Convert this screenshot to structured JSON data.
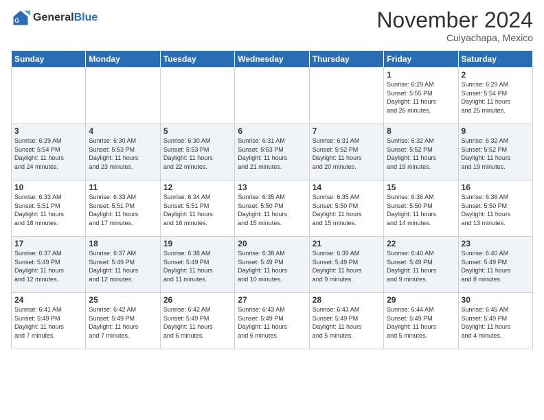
{
  "header": {
    "logo_general": "General",
    "logo_blue": "Blue",
    "month_title": "November 2024",
    "location": "Cuiyachapa, Mexico"
  },
  "weekdays": [
    "Sunday",
    "Monday",
    "Tuesday",
    "Wednesday",
    "Thursday",
    "Friday",
    "Saturday"
  ],
  "weeks": [
    [
      {
        "day": "",
        "info": ""
      },
      {
        "day": "",
        "info": ""
      },
      {
        "day": "",
        "info": ""
      },
      {
        "day": "",
        "info": ""
      },
      {
        "day": "",
        "info": ""
      },
      {
        "day": "1",
        "info": "Sunrise: 6:29 AM\nSunset: 5:55 PM\nDaylight: 11 hours\nand 26 minutes."
      },
      {
        "day": "2",
        "info": "Sunrise: 6:29 AM\nSunset: 5:54 PM\nDaylight: 11 hours\nand 25 minutes."
      }
    ],
    [
      {
        "day": "3",
        "info": "Sunrise: 6:29 AM\nSunset: 5:54 PM\nDaylight: 11 hours\nand 24 minutes."
      },
      {
        "day": "4",
        "info": "Sunrise: 6:30 AM\nSunset: 5:53 PM\nDaylight: 11 hours\nand 23 minutes."
      },
      {
        "day": "5",
        "info": "Sunrise: 6:30 AM\nSunset: 5:53 PM\nDaylight: 11 hours\nand 22 minutes."
      },
      {
        "day": "6",
        "info": "Sunrise: 6:31 AM\nSunset: 5:53 PM\nDaylight: 11 hours\nand 21 minutes."
      },
      {
        "day": "7",
        "info": "Sunrise: 6:31 AM\nSunset: 5:52 PM\nDaylight: 11 hours\nand 20 minutes."
      },
      {
        "day": "8",
        "info": "Sunrise: 6:32 AM\nSunset: 5:52 PM\nDaylight: 11 hours\nand 19 minutes."
      },
      {
        "day": "9",
        "info": "Sunrise: 6:32 AM\nSunset: 5:52 PM\nDaylight: 11 hours\nand 19 minutes."
      }
    ],
    [
      {
        "day": "10",
        "info": "Sunrise: 6:33 AM\nSunset: 5:51 PM\nDaylight: 11 hours\nand 18 minutes."
      },
      {
        "day": "11",
        "info": "Sunrise: 6:33 AM\nSunset: 5:51 PM\nDaylight: 11 hours\nand 17 minutes."
      },
      {
        "day": "12",
        "info": "Sunrise: 6:34 AM\nSunset: 5:51 PM\nDaylight: 11 hours\nand 16 minutes."
      },
      {
        "day": "13",
        "info": "Sunrise: 6:35 AM\nSunset: 5:50 PM\nDaylight: 11 hours\nand 15 minutes."
      },
      {
        "day": "14",
        "info": "Sunrise: 6:35 AM\nSunset: 5:50 PM\nDaylight: 11 hours\nand 15 minutes."
      },
      {
        "day": "15",
        "info": "Sunrise: 6:36 AM\nSunset: 5:50 PM\nDaylight: 11 hours\nand 14 minutes."
      },
      {
        "day": "16",
        "info": "Sunrise: 6:36 AM\nSunset: 5:50 PM\nDaylight: 11 hours\nand 13 minutes."
      }
    ],
    [
      {
        "day": "17",
        "info": "Sunrise: 6:37 AM\nSunset: 5:49 PM\nDaylight: 11 hours\nand 12 minutes."
      },
      {
        "day": "18",
        "info": "Sunrise: 6:37 AM\nSunset: 5:49 PM\nDaylight: 11 hours\nand 12 minutes."
      },
      {
        "day": "19",
        "info": "Sunrise: 6:38 AM\nSunset: 5:49 PM\nDaylight: 11 hours\nand 11 minutes."
      },
      {
        "day": "20",
        "info": "Sunrise: 6:38 AM\nSunset: 5:49 PM\nDaylight: 11 hours\nand 10 minutes."
      },
      {
        "day": "21",
        "info": "Sunrise: 6:39 AM\nSunset: 5:49 PM\nDaylight: 11 hours\nand 9 minutes."
      },
      {
        "day": "22",
        "info": "Sunrise: 6:40 AM\nSunset: 5:49 PM\nDaylight: 11 hours\nand 9 minutes."
      },
      {
        "day": "23",
        "info": "Sunrise: 6:40 AM\nSunset: 5:49 PM\nDaylight: 11 hours\nand 8 minutes."
      }
    ],
    [
      {
        "day": "24",
        "info": "Sunrise: 6:41 AM\nSunset: 5:49 PM\nDaylight: 11 hours\nand 7 minutes."
      },
      {
        "day": "25",
        "info": "Sunrise: 6:42 AM\nSunset: 5:49 PM\nDaylight: 11 hours\nand 7 minutes."
      },
      {
        "day": "26",
        "info": "Sunrise: 6:42 AM\nSunset: 5:49 PM\nDaylight: 11 hours\nand 6 minutes."
      },
      {
        "day": "27",
        "info": "Sunrise: 6:43 AM\nSunset: 5:49 PM\nDaylight: 11 hours\nand 6 minutes."
      },
      {
        "day": "28",
        "info": "Sunrise: 6:43 AM\nSunset: 5:49 PM\nDaylight: 11 hours\nand 5 minutes."
      },
      {
        "day": "29",
        "info": "Sunrise: 6:44 AM\nSunset: 5:49 PM\nDaylight: 11 hours\nand 5 minutes."
      },
      {
        "day": "30",
        "info": "Sunrise: 6:45 AM\nSunset: 5:49 PM\nDaylight: 11 hours\nand 4 minutes."
      }
    ]
  ]
}
